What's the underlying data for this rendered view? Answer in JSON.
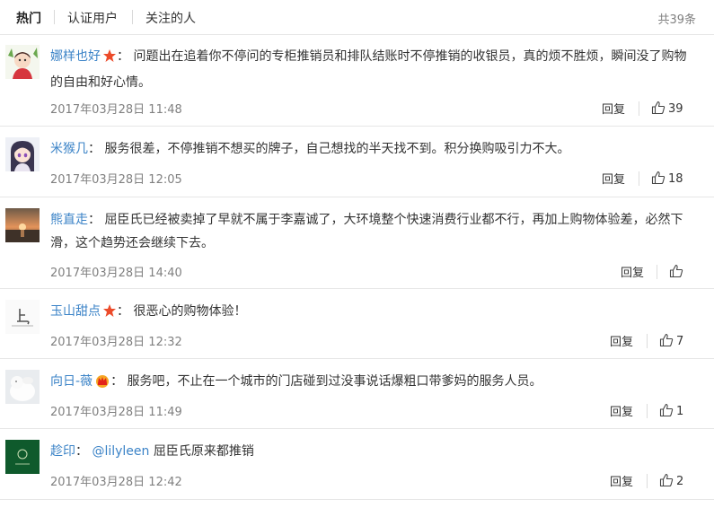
{
  "tabs": [
    {
      "label": "热门"
    },
    {
      "label": "认证用户"
    },
    {
      "label": "关注的人"
    }
  ],
  "total": "共39条",
  "colors": {
    "link": "#3b83c7",
    "meta": "#808080",
    "divider": "#e6e6e6"
  },
  "comments": [
    {
      "user": "娜样也好",
      "badge": "star-icon",
      "separator": "：",
      "text": "问题出在追着你不停问的专柜推销员和排队结账时不停推销的收银员，真的烦不胜烦，瞬间没了购物的自由和好心情。",
      "time": "2017年03月28日 11:48",
      "reply": "回复",
      "likes": "39"
    },
    {
      "user": "米猴几",
      "badge": "",
      "separator": "：",
      "text": "服务很差，不停推销不想买的牌子，自己想找的半天找不到。积分换购吸引力不大。",
      "time": "2017年03月28日 12:05",
      "reply": "回复",
      "likes": "18"
    },
    {
      "user": "熊直走",
      "badge": "",
      "separator": "：",
      "text": "屈臣氏已经被卖掉了早就不属于李嘉诚了，大环境整个快速消费行业都不行，再加上购物体验差，必然下滑，这个趋势还会继续下去。",
      "time": "2017年03月28日 14:40",
      "reply": "回复",
      "likes": ""
    },
    {
      "user": "玉山甜点",
      "badge": "star-icon",
      "separator": "：",
      "text": "很恶心的购物体验！",
      "time": "2017年03月28日 12:32",
      "reply": "回复",
      "likes": "7"
    },
    {
      "user": "向日-薇",
      "badge": "crown-icon",
      "separator": "：",
      "text": "服务吧，不止在一个城市的门店碰到过没事说话爆粗口带爹妈的服务人员。",
      "time": "2017年03月28日 11:49",
      "reply": "回复",
      "likes": "1"
    },
    {
      "user": "趁印",
      "badge": "",
      "separator": "：",
      "mention": "@lilyleen",
      "text": "屈臣氏原来都推销",
      "time": "2017年03月28日 12:42",
      "reply": "回复",
      "likes": "2"
    }
  ]
}
